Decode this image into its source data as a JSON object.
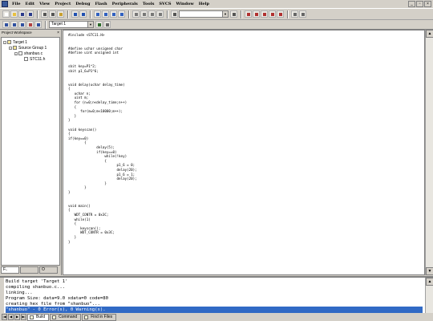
{
  "menubar": {
    "items": [
      "File",
      "Edit",
      "View",
      "Project",
      "Debug",
      "Flash",
      "Peripherals",
      "Tools",
      "SVCS",
      "Window",
      "Help"
    ]
  },
  "toolbar": {
    "target": "Target 1"
  },
  "workspace": {
    "title": "Project Workspace",
    "tree": {
      "target": "Target 1",
      "group": "Source Group 1",
      "file": "shanbuo.c",
      "header": "STC11.h"
    },
    "tabs": [
      "F..",
      "",
      "O"
    ]
  },
  "editor": {
    "lines": [
      "#include <STC11.H>",
      "",
      "",
      "#define uchar unsigned char",
      "#define uint unsigned int",
      "",
      "",
      "sbit key=P1^2;",
      "sbit p1_6=P1^6;",
      "",
      "",
      "void delay(uchar delay_time)",
      "{",
      "   uchar n;",
      "   uint m;",
      "   for (n=0;n<delay_time;n++)",
      "   {",
      "      for(m=0;m<10000;m++);",
      "   }",
      "}",
      "",
      "void keyscan()",
      "{",
      "if(key==0)",
      "        {",
      "              delay(5);",
      "              if(key==0)",
      "                  while(!key)",
      "                  {",
      "                        p1_6 = 0;",
      "                        delay(20);",
      "                        p1_6 = 1;",
      "                        delay(20);",
      "                  }",
      "        }",
      "}",
      "",
      "",
      "void main()",
      "{",
      "   WDT_CONTR = 0x3C;",
      "   while(1)",
      "   {",
      "      keyscan();",
      "      WDT_CONTR = 0x3C;",
      "   }",
      "}"
    ]
  },
  "output": {
    "lines": [
      "Build target 'Target 1'",
      "compiling shanbuo.c...",
      "linking...",
      "Program Size: data=9.0 xdata=0 code=80",
      "creating hex file from \"shanbuo\"...",
      "\"shanbuo\" - 0 Error(s), 0 Warning(s)."
    ]
  },
  "bottom_tabs": [
    "Build",
    "Command",
    "Find in Files"
  ],
  "colors": {
    "selection": "#316ac5",
    "chrome": "#d4d0c8"
  }
}
